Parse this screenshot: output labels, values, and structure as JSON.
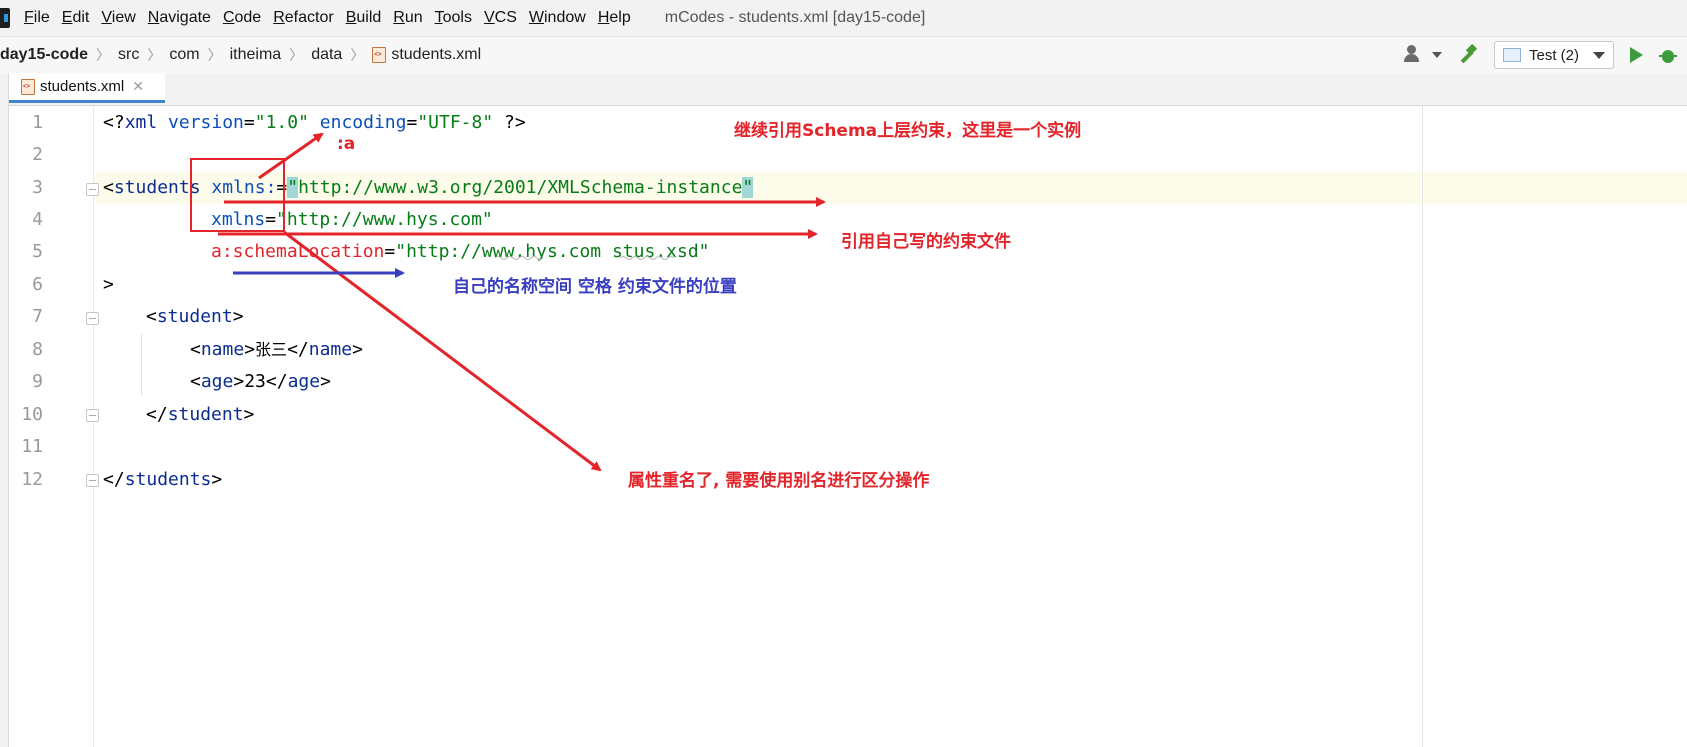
{
  "menubar": {
    "items": [
      "File",
      "Edit",
      "View",
      "Navigate",
      "Code",
      "Refactor",
      "Build",
      "Run",
      "Tools",
      "VCS",
      "Window",
      "Help"
    ],
    "window_title": "mCodes - students.xml [day15-code]"
  },
  "breadcrumb": {
    "items": [
      "day15-code",
      "src",
      "com",
      "itheima",
      "data",
      "students.xml"
    ]
  },
  "toolbar": {
    "run_config_label": "Test (2)"
  },
  "tabs": [
    {
      "label": "students.xml",
      "active": true
    }
  ],
  "editor": {
    "line_numbers": [
      "1",
      "2",
      "3",
      "4",
      "5",
      "6",
      "7",
      "8",
      "9",
      "10",
      "11",
      "12"
    ],
    "current_line": 3,
    "lines": {
      "l1": {
        "open": "<?",
        "tag": "xml",
        "a1": " version",
        "eq1": "=",
        "v1": "\"1.0\"",
        "a2": " encoding",
        "eq2": "=",
        "v2": "\"UTF-8\"",
        "close": " ?>"
      },
      "l3": {
        "lt": "<",
        "tag": "students",
        "attr": " xmlns:",
        "eq": "=",
        "q1": "\"",
        "val": "http://www.w3.org/2001/XMLSchema-instance",
        "q2": "\""
      },
      "l4": {
        "attr": "xmlns",
        "eq": "=",
        "val": "\"http://www.hys.com\""
      },
      "l5": {
        "attr": "a:schemaLocation",
        "eq": "=",
        "val": "\"http://www.hys.com stus.xsd\""
      },
      "l6": {
        "gt": ">"
      },
      "l7": {
        "lt": "<",
        "tag": "student",
        "gt": ">"
      },
      "l8": {
        "lt": "<",
        "tag": "name",
        "gt": ">",
        "text": "张三",
        "clt": "</",
        "ctag": "name",
        "cgt": ">"
      },
      "l9": {
        "lt": "<",
        "tag": "age",
        "gt": ">",
        "text": "23",
        "clt": "</",
        "ctag": "age",
        "cgt": ">"
      },
      "l10": {
        "clt": "</",
        "ctag": "student",
        "cgt": ">"
      },
      "l12": {
        "clt": "</",
        "ctag": "students",
        "cgt": ">"
      }
    }
  },
  "annotations": {
    "colon_a": ":a",
    "inherit_schema": "继续引用Schema上层约束，这里是一个实例",
    "own_constraint": "引用自己写的约束文件",
    "namespace_location": "自己的名称空间  空格 约束文件的位置",
    "duplicate_attr": "属性重名了, 需要使用别名进行区分操作"
  },
  "colors": {
    "annotation_red": "#e3252b",
    "annotation_blue": "#3a3fbf",
    "xml_tag": "#0b2d91",
    "xml_value": "#067d17"
  }
}
